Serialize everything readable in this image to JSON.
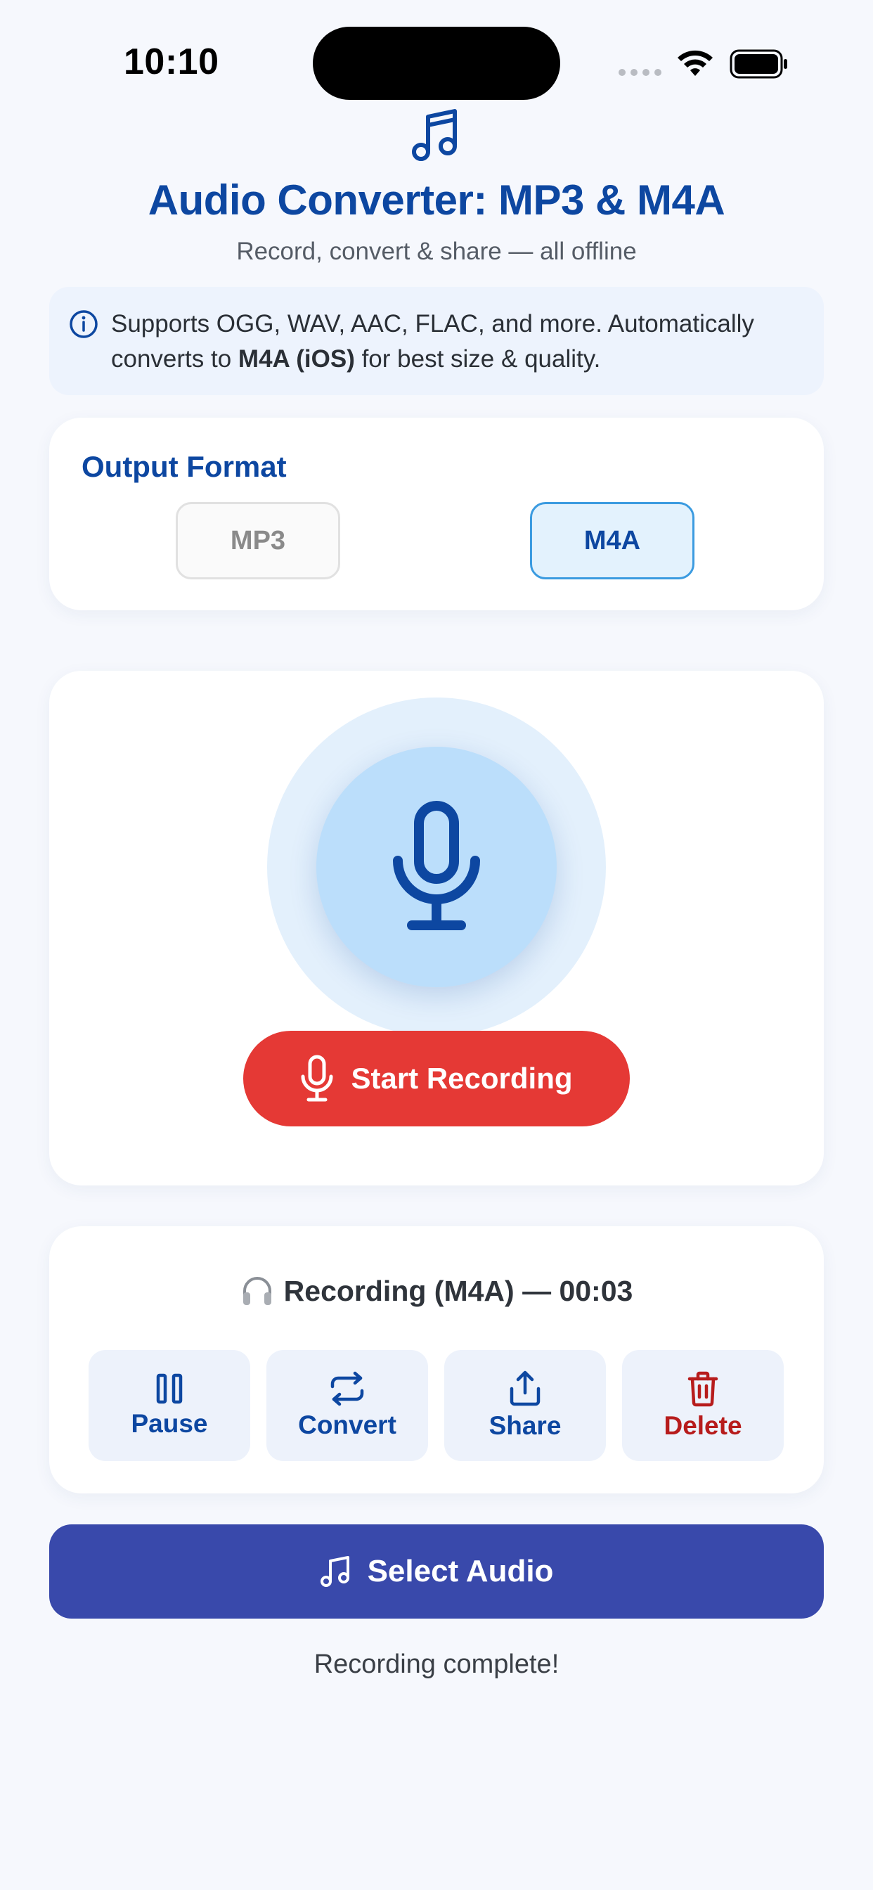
{
  "status_bar": {
    "time": "10:10"
  },
  "header": {
    "title": "Audio Converter: MP3 & M4A",
    "subtitle": "Record, convert & share — all offline",
    "icon": "music-note-icon"
  },
  "info": {
    "text_before": "Supports OGG, WAV, AAC, FLAC, and more. Automatically converts to ",
    "text_bold": "M4A (iOS)",
    "text_after": " for best size & quality."
  },
  "output_format": {
    "label": "Output Format",
    "options": [
      "MP3",
      "M4A"
    ],
    "selected": "M4A"
  },
  "recorder": {
    "start_label": "Start Recording"
  },
  "recording_status": {
    "text": "Recording (M4A) — 00:03",
    "actions": [
      {
        "label": "Pause",
        "icon": "pause-icon"
      },
      {
        "label": "Convert",
        "icon": "convert-icon"
      },
      {
        "label": "Share",
        "icon": "share-icon"
      },
      {
        "label": "Delete",
        "icon": "trash-icon"
      }
    ]
  },
  "select_audio": {
    "label": "Select Audio"
  },
  "footer": {
    "message": "Recording complete!"
  },
  "colors": {
    "primary": "#0d47a1",
    "record": "#e53935",
    "select": "#3949ab",
    "delete": "#b71c1c"
  }
}
